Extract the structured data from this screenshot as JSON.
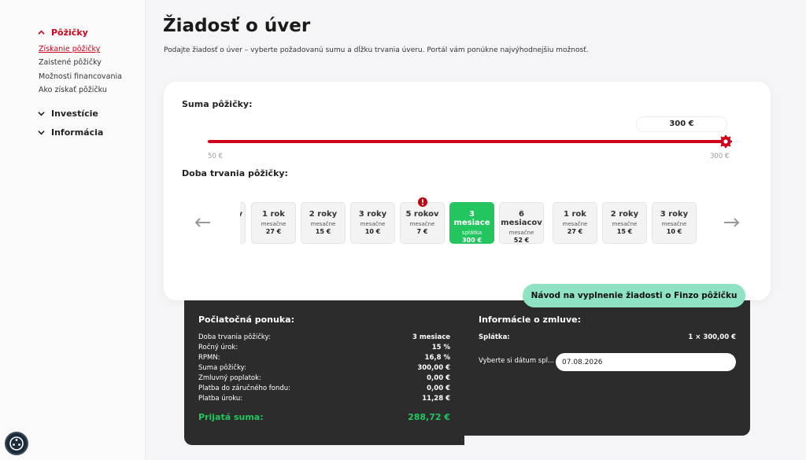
{
  "sidebar": {
    "groups": [
      {
        "label": "Pôžičky",
        "items": [
          "Získanie pôžičky",
          "Zaistené pôžičky",
          "Možnosti financovania",
          "Ako získať pôžičku"
        ]
      },
      {
        "label": "Investície"
      },
      {
        "label": "Informácia"
      }
    ]
  },
  "header": {
    "title": "Žiadosť o úver",
    "description": "Podajte žiadosť o úver – vyberte požadovanú sumu a dĺžku trvania úveru. Portál vám ponúkne najvýhodnejšiu možnosť."
  },
  "loan": {
    "amount_label": "Suma pôžičky:",
    "amount_value": "300 €",
    "amount_fraction": 1.0,
    "min_label": "50 €",
    "max_label": "300 €",
    "duration_label": "Doba trvania pôžičky:",
    "partial_first_option": "v",
    "options": [
      {
        "title": "1 rok",
        "sub": "mesačne",
        "value": "27 €"
      },
      {
        "title": "2 roky",
        "sub": "mesačne",
        "value": "15 €"
      },
      {
        "title": "3 roky",
        "sub": "mesačne",
        "value": "10 €"
      },
      {
        "title": "5 rokov",
        "sub": "mesačne",
        "value": "7 €"
      },
      {
        "title": "3 mesiace",
        "sub": "splátka",
        "value": "300 €"
      },
      {
        "title": "6 mesiacov",
        "sub": "mesačne",
        "value": "52 €"
      },
      {
        "title": "1 rok",
        "sub": "mesačne",
        "value": "27 €"
      },
      {
        "title": "2 roky",
        "sub": "mesačne",
        "value": "15 €"
      },
      {
        "title": "3 roky",
        "sub": "mesačne",
        "value": "10 €"
      }
    ]
  },
  "guide_button": "Návod na vyplnenie žiadosti o Finzo pôžičku",
  "offer": {
    "title": "Počiatočná ponuka:",
    "rows": [
      {
        "label": "Doba trvania pôžičky:",
        "value": "3 mesiace"
      },
      {
        "label": "Ročný úrok:",
        "value": "15 %"
      },
      {
        "label": "RPMN:",
        "value": "16,8 %"
      },
      {
        "label": "Suma pôžičky:",
        "value": "300,00 €"
      },
      {
        "label": "Zmluvný poplatok:",
        "value": "0,00 €"
      },
      {
        "label": "Platba do záručného fondu:",
        "value": "0,00 €"
      },
      {
        "label": "Platba úroku:",
        "value": "11,28 €"
      }
    ],
    "received_label": "Prijatá suma:",
    "received_value": "288,72 €"
  },
  "contract": {
    "title": "Informácie o zmluve:",
    "installment_label": "Splátka:",
    "installment_value": "1 × 300,00 €",
    "date_label": "Vyberte si dátum spl...",
    "date_value": "07.08.2026"
  },
  "colors": {
    "accent": "#d0021b",
    "selected": "#22c55e",
    "dark_panel": "#2c2c2c",
    "guide_button": "#8ee3c2"
  }
}
